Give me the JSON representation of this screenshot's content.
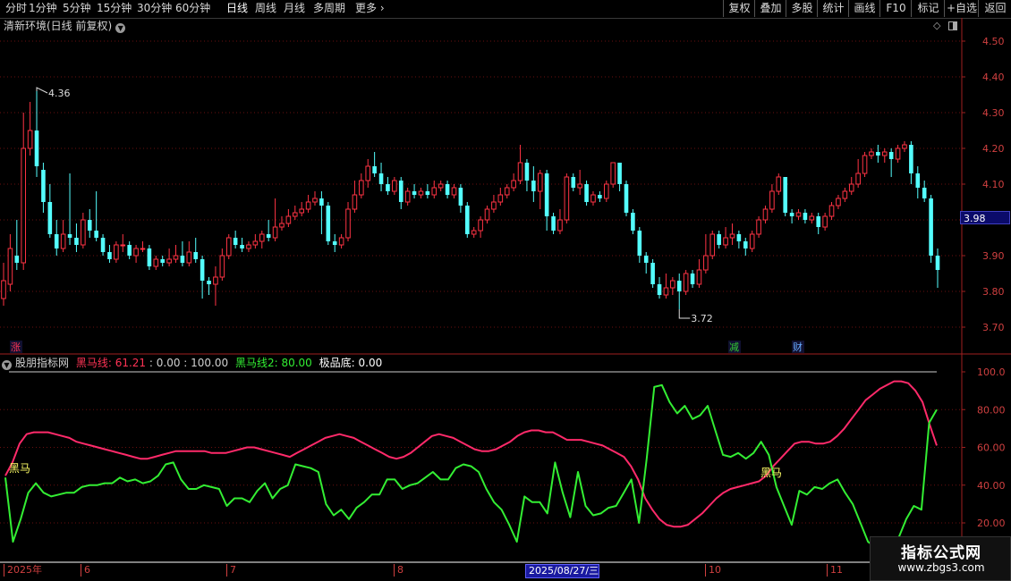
{
  "toolbar": {
    "left_items": [
      "分时",
      "1分钟",
      "5分钟",
      "15分钟",
      "30分钟",
      "60分钟",
      "日线",
      "周线",
      "月线",
      "多周期",
      "更多"
    ],
    "active": "日线",
    "right_items": [
      "复权",
      "叠加",
      "多股",
      "统计",
      "画线",
      "F10",
      "标记",
      "+自选",
      "返回"
    ]
  },
  "main_panel": {
    "title": "清新环境(日线 前复权)",
    "price_axis": [
      "4.50",
      "4.40",
      "4.30",
      "4.20",
      "4.10",
      "4.00",
      "3.90",
      "3.80",
      "3.70"
    ],
    "current_price": "3.98",
    "high_annotation": "4.36",
    "low_annotation": "3.72",
    "markers": [
      {
        "text": "涨",
        "color": "#ff3355"
      },
      {
        "text": "减",
        "color": "#33cc33"
      },
      {
        "text": "财",
        "color": "#66aaff"
      }
    ]
  },
  "indicator_panel": {
    "name": "股朋指标网",
    "line1_label": "黑马线: 61.21",
    "params": ": 0.00 : 100.00",
    "line2_label": "黑马线2: 80.00",
    "line3_label": "极品底: 0.00",
    "axis": [
      "100.0",
      "80.00",
      "60.00",
      "40.00",
      "20.00"
    ],
    "signal_text": "黑马",
    "colors": {
      "line1": "#ff2a6a",
      "line2": "#33ee33",
      "label1": "#ff3355",
      "label2": "#33ee33",
      "signal": "#ffff66"
    }
  },
  "date_axis": [
    {
      "text": "2025年"
    },
    {
      "text": "6"
    },
    {
      "text": "7"
    },
    {
      "text": "8"
    },
    {
      "text": "2025/08/27/三",
      "selected": true
    },
    {
      "text": "10"
    },
    {
      "text": "11"
    }
  ],
  "watermark": {
    "title": "指标公式网",
    "url": "www.zbgs3.com"
  },
  "chart_data": {
    "type": "candlestick",
    "ylim": [
      3.65,
      4.55
    ],
    "candles": [
      [
        3.78,
        3.83,
        3.76,
        3.88
      ],
      [
        3.82,
        3.92,
        3.8,
        3.96
      ],
      [
        3.9,
        3.88,
        3.86,
        4.0
      ],
      [
        3.88,
        4.2,
        3.86,
        4.3
      ],
      [
        4.2,
        4.25,
        4.18,
        4.33
      ],
      [
        4.25,
        4.15,
        4.12,
        4.36
      ],
      [
        4.14,
        4.05,
        4.02,
        4.16
      ],
      [
        4.05,
        3.96,
        3.95,
        4.1
      ],
      [
        3.96,
        3.92,
        3.9,
        4.0
      ],
      [
        3.92,
        3.96,
        3.91,
        4.0
      ],
      [
        3.96,
        3.95,
        3.93,
        4.13
      ],
      [
        3.95,
        3.93,
        3.91,
        3.99
      ],
      [
        3.93,
        4.0,
        3.92,
        4.02
      ],
      [
        4.0,
        3.97,
        3.95,
        4.03
      ],
      [
        3.97,
        3.95,
        3.94,
        4.08
      ],
      [
        3.95,
        3.91,
        3.9,
        3.96
      ],
      [
        3.91,
        3.89,
        3.88,
        3.93
      ],
      [
        3.89,
        3.93,
        3.88,
        3.94
      ],
      [
        3.93,
        3.93,
        3.91,
        3.96
      ],
      [
        3.93,
        3.9,
        3.89,
        3.94
      ],
      [
        3.9,
        3.92,
        3.88,
        3.93
      ],
      [
        3.92,
        3.92,
        3.91,
        3.94
      ],
      [
        3.92,
        3.87,
        3.86,
        3.93
      ],
      [
        3.87,
        3.89,
        3.86,
        3.9
      ],
      [
        3.89,
        3.88,
        3.87,
        3.9
      ],
      [
        3.88,
        3.89,
        3.87,
        3.92
      ],
      [
        3.89,
        3.9,
        3.88,
        3.93
      ],
      [
        3.9,
        3.88,
        3.87,
        3.94
      ],
      [
        3.88,
        3.91,
        3.87,
        3.94
      ],
      [
        3.91,
        3.89,
        3.88,
        3.95
      ],
      [
        3.89,
        3.83,
        3.78,
        3.9
      ],
      [
        3.83,
        3.82,
        3.79,
        3.84
      ],
      [
        3.82,
        3.84,
        3.76,
        3.87
      ],
      [
        3.84,
        3.9,
        3.83,
        3.92
      ],
      [
        3.9,
        3.95,
        3.89,
        3.96
      ],
      [
        3.95,
        3.93,
        3.92,
        3.97
      ],
      [
        3.93,
        3.92,
        3.91,
        3.95
      ],
      [
        3.92,
        3.93,
        3.91,
        3.94
      ],
      [
        3.93,
        3.94,
        3.92,
        3.96
      ],
      [
        3.94,
        3.96,
        3.92,
        3.97
      ],
      [
        3.96,
        3.95,
        3.94,
        4.0
      ],
      [
        3.95,
        3.98,
        3.94,
        4.06
      ],
      [
        3.98,
        3.99,
        3.97,
        4.01
      ],
      [
        3.99,
        4.01,
        3.98,
        4.03
      ],
      [
        4.01,
        4.02,
        4.0,
        4.04
      ],
      [
        4.02,
        4.03,
        4.01,
        4.05
      ],
      [
        4.03,
        4.05,
        4.02,
        4.07
      ],
      [
        4.05,
        4.06,
        4.04,
        4.08
      ],
      [
        4.06,
        4.04,
        3.96,
        4.08
      ],
      [
        4.04,
        3.94,
        3.93,
        4.05
      ],
      [
        3.94,
        3.93,
        3.91,
        3.96
      ],
      [
        3.93,
        3.95,
        3.92,
        3.96
      ],
      [
        3.95,
        4.03,
        3.94,
        4.05
      ],
      [
        4.03,
        4.07,
        4.02,
        4.11
      ],
      [
        4.07,
        4.11,
        4.06,
        4.13
      ],
      [
        4.11,
        4.15,
        4.09,
        4.17
      ],
      [
        4.15,
        4.13,
        4.12,
        4.19
      ],
      [
        4.13,
        4.1,
        4.08,
        4.16
      ],
      [
        4.1,
        4.08,
        4.07,
        4.12
      ],
      [
        4.08,
        4.11,
        4.07,
        4.12
      ],
      [
        4.11,
        4.05,
        4.03,
        4.12
      ],
      [
        4.05,
        4.08,
        4.04,
        4.09
      ],
      [
        4.08,
        4.07,
        4.06,
        4.1
      ],
      [
        4.07,
        4.08,
        4.06,
        4.09
      ],
      [
        4.08,
        4.07,
        4.06,
        4.1
      ],
      [
        4.07,
        4.09,
        4.06,
        4.11
      ],
      [
        4.09,
        4.1,
        4.08,
        4.11
      ],
      [
        4.1,
        4.07,
        4.06,
        4.11
      ],
      [
        4.07,
        4.09,
        4.06,
        4.1
      ],
      [
        4.09,
        4.04,
        4.02,
        4.1
      ],
      [
        4.04,
        3.96,
        3.95,
        4.05
      ],
      [
        3.96,
        3.97,
        3.95,
        3.98
      ],
      [
        3.97,
        4.0,
        3.95,
        4.01
      ],
      [
        4.0,
        4.03,
        3.99,
        4.04
      ],
      [
        4.03,
        4.05,
        4.02,
        4.07
      ],
      [
        4.05,
        4.07,
        4.04,
        4.09
      ],
      [
        4.07,
        4.09,
        4.06,
        4.1
      ],
      [
        4.09,
        4.11,
        4.08,
        4.13
      ],
      [
        4.11,
        4.16,
        4.1,
        4.21
      ],
      [
        4.16,
        4.11,
        4.08,
        4.17
      ],
      [
        4.11,
        4.08,
        4.05,
        4.15
      ],
      [
        4.08,
        4.13,
        4.03,
        4.14
      ],
      [
        4.13,
        4.01,
        3.97,
        4.14
      ],
      [
        4.01,
        3.97,
        3.96,
        4.02
      ],
      [
        3.97,
        4.0,
        3.96,
        4.03
      ],
      [
        4.0,
        4.12,
        3.99,
        4.13
      ],
      [
        4.12,
        4.09,
        4.08,
        4.13
      ],
      [
        4.09,
        4.1,
        4.07,
        4.14
      ],
      [
        4.1,
        4.05,
        4.04,
        4.11
      ],
      [
        4.05,
        4.07,
        4.04,
        4.08
      ],
      [
        4.07,
        4.06,
        4.05,
        4.08
      ],
      [
        4.06,
        4.1,
        4.05,
        4.11
      ],
      [
        4.1,
        4.16,
        4.09,
        4.16
      ],
      [
        4.16,
        4.1,
        4.08,
        4.16
      ],
      [
        4.1,
        4.02,
        4.01,
        4.11
      ],
      [
        4.02,
        3.97,
        3.96,
        4.03
      ],
      [
        3.97,
        3.9,
        3.88,
        3.98
      ],
      [
        3.9,
        3.88,
        3.85,
        3.91
      ],
      [
        3.88,
        3.82,
        3.81,
        3.89
      ],
      [
        3.82,
        3.79,
        3.78,
        3.84
      ],
      [
        3.79,
        3.81,
        3.78,
        3.85
      ],
      [
        3.81,
        3.83,
        3.79,
        3.84
      ],
      [
        3.83,
        3.8,
        3.75,
        3.85
      ],
      [
        3.8,
        3.85,
        3.79,
        3.86
      ],
      [
        3.85,
        3.82,
        3.81,
        3.86
      ],
      [
        3.82,
        3.86,
        3.81,
        3.89
      ],
      [
        3.86,
        3.9,
        3.85,
        3.96
      ],
      [
        3.9,
        3.96,
        3.89,
        3.97
      ],
      [
        3.96,
        3.93,
        3.92,
        3.97
      ],
      [
        3.93,
        3.95,
        3.92,
        3.98
      ],
      [
        3.95,
        3.96,
        3.93,
        3.99
      ],
      [
        3.96,
        3.94,
        3.92,
        3.97
      ],
      [
        3.94,
        3.92,
        3.9,
        3.95
      ],
      [
        3.92,
        3.96,
        3.91,
        3.97
      ],
      [
        3.96,
        4.0,
        3.95,
        4.01
      ],
      [
        4.0,
        4.03,
        3.99,
        4.04
      ],
      [
        4.03,
        4.08,
        4.02,
        4.1
      ],
      [
        4.08,
        4.12,
        4.07,
        4.13
      ],
      [
        4.12,
        4.02,
        4.01,
        4.12
      ],
      [
        4.02,
        4.01,
        3.99,
        4.03
      ],
      [
        4.01,
        4.02,
        4.0,
        4.03
      ],
      [
        4.02,
        4.0,
        3.99,
        4.03
      ],
      [
        4.0,
        4.01,
        3.99,
        4.02
      ],
      [
        4.01,
        3.98,
        3.96,
        4.02
      ],
      [
        3.98,
        4.01,
        3.97,
        4.02
      ],
      [
        4.01,
        4.04,
        4.0,
        4.05
      ],
      [
        4.04,
        4.06,
        4.03,
        4.07
      ],
      [
        4.06,
        4.08,
        4.05,
        4.09
      ],
      [
        4.08,
        4.1,
        4.07,
        4.12
      ],
      [
        4.1,
        4.13,
        4.09,
        4.17
      ],
      [
        4.13,
        4.18,
        4.12,
        4.19
      ],
      [
        4.18,
        4.19,
        4.17,
        4.2
      ],
      [
        4.19,
        4.18,
        4.16,
        4.21
      ],
      [
        4.18,
        4.19,
        4.16,
        4.2
      ],
      [
        4.19,
        4.17,
        4.12,
        4.2
      ],
      [
        4.17,
        4.2,
        4.16,
        4.21
      ],
      [
        4.2,
        4.21,
        4.19,
        4.22
      ],
      [
        4.21,
        4.13,
        4.1,
        4.22
      ],
      [
        4.13,
        4.09,
        4.06,
        4.15
      ],
      [
        4.09,
        4.06,
        4.05,
        4.11
      ],
      [
        4.06,
        3.9,
        3.88,
        4.07
      ],
      [
        3.9,
        3.86,
        3.81,
        3.92
      ]
    ],
    "indicator": {
      "ylim": [
        5,
        105
      ],
      "line1": [
        45,
        52,
        62,
        67,
        68,
        68,
        68,
        67,
        66,
        65,
        63,
        62,
        61,
        60,
        59,
        58,
        57,
        56,
        55,
        54,
        54,
        55,
        56,
        57,
        58,
        58,
        58,
        58,
        58,
        57,
        57,
        57,
        58,
        59,
        60,
        60,
        59,
        58,
        57,
        56,
        55,
        57,
        59,
        61,
        63,
        65,
        66,
        67,
        66,
        65,
        63,
        61,
        59,
        57,
        55,
        54,
        55,
        57,
        60,
        63,
        66,
        67,
        66,
        65,
        63,
        61,
        59,
        58,
        58,
        59,
        61,
        63,
        66,
        68,
        69,
        69,
        68,
        68,
        66,
        64,
        64,
        64,
        63,
        62,
        61,
        59,
        57,
        55,
        50,
        43,
        33,
        27,
        22,
        19,
        18,
        18,
        19,
        22,
        25,
        29,
        33,
        36,
        38,
        39,
        40,
        41,
        42,
        45,
        50,
        54,
        58,
        62,
        63,
        63,
        62,
        62,
        63,
        66,
        70,
        75,
        80,
        85,
        88,
        91,
        93,
        95,
        95,
        94,
        90,
        84,
        72,
        61
      ],
      "line2": [
        44,
        10,
        22,
        36,
        41,
        36,
        34,
        35,
        36,
        36,
        39,
        40,
        40,
        41,
        41,
        44,
        42,
        43,
        41,
        42,
        45,
        51,
        52,
        43,
        38,
        38,
        40,
        39,
        38,
        29,
        33,
        33,
        31,
        37,
        41,
        33,
        38,
        40,
        51,
        50,
        49,
        47,
        30,
        24,
        27,
        22,
        28,
        31,
        35,
        35,
        43,
        43,
        38,
        40,
        41,
        44,
        47,
        43,
        43,
        49,
        51,
        50,
        47,
        38,
        31,
        27,
        19,
        10,
        34,
        31,
        31,
        25,
        52,
        36,
        23,
        47,
        29,
        24,
        25,
        28,
        29,
        36,
        43,
        20,
        54,
        92,
        93,
        84,
        78,
        82,
        75,
        77,
        82,
        69,
        56,
        55,
        57,
        54,
        57,
        63,
        56,
        39,
        29,
        19,
        37,
        35,
        39,
        38,
        41,
        43,
        36,
        30,
        20,
        10,
        7,
        6,
        8,
        12,
        22,
        29,
        27,
        73,
        80
      ]
    }
  }
}
